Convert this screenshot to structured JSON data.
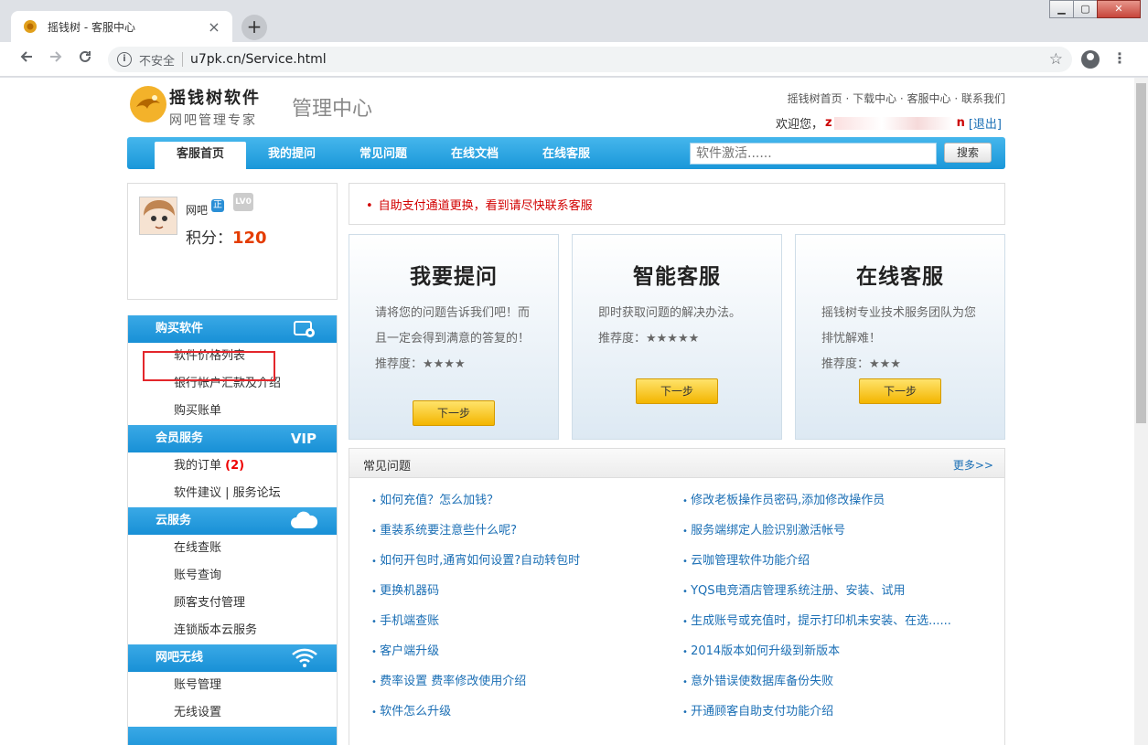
{
  "browser": {
    "tab_title": "摇钱树 - 客服中心",
    "tab_close": "×",
    "new_tab": "+",
    "insecure_label": "不安全",
    "url": "u7pk.cn/Service.html",
    "window_controls": [
      "▁",
      "▢",
      "✕"
    ]
  },
  "header": {
    "brand_name": "摇钱树软件",
    "brand_slogan": "网吧管理专家",
    "section_title": "管理中心",
    "top_links": "摇钱树首页 · 下载中心 · 客服中心 · 联系我们",
    "welcome_prefix": "欢迎您，",
    "username_initial": "z",
    "username_tail": "n",
    "logout": "[退出]"
  },
  "nav": {
    "items": [
      "客服首页",
      "我的提问",
      "常见问题",
      "在线文档",
      "在线客服"
    ],
    "search_placeholder": "软件激活......",
    "search_button": "搜索"
  },
  "user": {
    "name": "网吧",
    "badge": "正",
    "level": "LV0",
    "points_label": "积分：",
    "points_value": "120"
  },
  "sidebar": {
    "sections": [
      {
        "title": "购买软件",
        "icon": "shopping-icon",
        "items": [
          "软件价格列表",
          "银行帐户汇款及介绍",
          "购买账单"
        ]
      },
      {
        "title": "会员服务",
        "icon_text": "VIP",
        "items": [
          "我的订单",
          "软件建议 | 服务论坛"
        ]
      },
      {
        "title": "云服务",
        "icon": "cloud-icon",
        "items": [
          "在线查账",
          "账号查询",
          "顾客支付管理",
          "连锁版本云服务"
        ]
      },
      {
        "title": "网吧无线",
        "icon": "wifi-icon",
        "items": [
          "账号管理",
          "无线设置"
        ]
      }
    ],
    "order_count": "(2)"
  },
  "notice": {
    "text": "自助支付通道更换，看到请尽快联系客服"
  },
  "cards": [
    {
      "title": "我要提问",
      "desc": "请将您的问题告诉我们吧！而且一定会得到满意的答复的！",
      "rec": "推荐度：★★★★",
      "button": "下一步"
    },
    {
      "title": "智能客服",
      "desc": "即时获取问题的解决办法。",
      "rec": "推荐度：★★★★★",
      "button": "下一步"
    },
    {
      "title": "在线客服",
      "desc": "摇钱树专业技术服务团队为您排忧解难！",
      "rec": "推荐度：★★★",
      "button": "下一步"
    }
  ],
  "faq": {
    "title": "常见问题",
    "more": "更多>>",
    "left": [
      "如何充值？怎么加钱？",
      "重装系统要注意些什么呢?",
      "如何开包时,通宵如何设置?自动转包时",
      "更换机器码",
      "手机端查账",
      "客户端升级",
      "费率设置 费率修改使用介绍",
      "软件怎么升级"
    ],
    "right": [
      "修改老板操作员密码,添加修改操作员",
      "服务端绑定人脸识别激活帐号",
      "云咖管理软件功能介绍",
      "YQS电竞酒店管理系统注册、安装、试用",
      "生成账号或充值时，提示打印机未安装、在选......",
      "2014版本如何升级到新版本",
      "意外错误使数据库备份失败",
      "开通顾客自助支付功能介绍"
    ]
  },
  "colors": {
    "nav_blue": "#1a97d9",
    "link_blue": "#1b6fb5",
    "notice_red": "#d20000",
    "points_orange": "#e43c00",
    "button_yellow": "#f3b500",
    "highlight_red": "#e3262b"
  }
}
